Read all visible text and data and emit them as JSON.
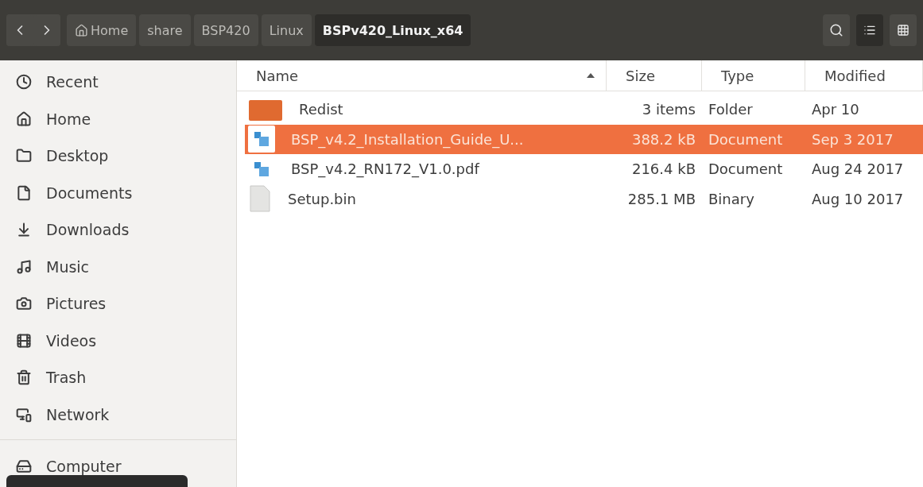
{
  "toolbar": {
    "breadcrumbs": [
      {
        "label": "Home",
        "kind": "home",
        "selected": false
      },
      {
        "label": "share",
        "kind": "plain",
        "selected": false
      },
      {
        "label": "BSP420",
        "kind": "plain",
        "selected": false
      },
      {
        "label": "Linux",
        "kind": "plain",
        "selected": false
      },
      {
        "label": "BSPv420_Linux_x64",
        "kind": "plain",
        "selected": true
      }
    ],
    "view_buttons": [
      {
        "kind": "list",
        "selected": true
      },
      {
        "kind": "grid",
        "selected": false
      }
    ]
  },
  "sidebar": {
    "items": [
      {
        "label": "Recent",
        "kind": "place"
      },
      {
        "label": "Home",
        "kind": "place"
      },
      {
        "label": "Desktop",
        "kind": "place"
      },
      {
        "label": "Documents",
        "kind": "place"
      },
      {
        "label": "Downloads",
        "kind": "place"
      },
      {
        "label": "Music",
        "kind": "place"
      },
      {
        "label": "Pictures",
        "kind": "place"
      },
      {
        "label": "Videos",
        "kind": "place"
      },
      {
        "label": "Trash",
        "kind": "place"
      },
      {
        "label": "Network",
        "kind": "place"
      },
      {
        "label": "Computer",
        "kind": "device"
      }
    ]
  },
  "table": {
    "columns": [
      {
        "label": "Name",
        "sorted": true
      },
      {
        "label": "Size",
        "sorted": false
      },
      {
        "label": "Type",
        "sorted": false
      },
      {
        "label": "Modified",
        "sorted": false
      }
    ],
    "rows": [
      {
        "kind": "folder",
        "name": "Redist",
        "size": "3 items",
        "type": "Folder",
        "modified": "Apr 10",
        "selected": false
      },
      {
        "kind": "document",
        "name": "BSP_v4.2_Installation_Guide_U...",
        "size": "388.2 kB",
        "type": "Document",
        "modified": "Sep 3 2017",
        "selected": true
      },
      {
        "kind": "document",
        "name": "BSP_v4.2_RN172_V1.0.pdf",
        "size": "216.4 kB",
        "type": "Document",
        "modified": "Aug 24 2017",
        "selected": false
      },
      {
        "kind": "binary",
        "name": "Setup.bin",
        "size": "285.1 MB",
        "type": "Binary",
        "modified": "Aug 10 2017",
        "selected": false
      }
    ]
  }
}
